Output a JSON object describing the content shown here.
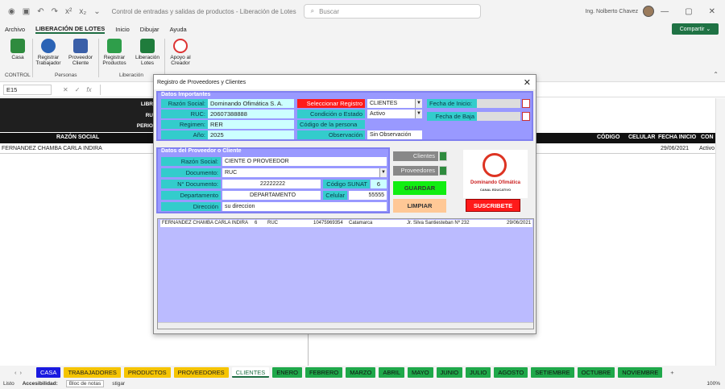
{
  "titlebar": {
    "doc_title": "Control de entradas y salidas de productos - Liberación de Lotes - copia - E...",
    "search_placeholder": "Buscar",
    "user_name": "Ing. Nolberto Chavez"
  },
  "menu": [
    "Archivo",
    "LIBERACIÓN DE LOTES",
    "Inicio",
    "Dibujar",
    "Ayuda"
  ],
  "share_label": "Compartir",
  "ribbon": {
    "buttons": [
      {
        "label": "Casa"
      },
      {
        "label": "Registrar Trabajador"
      },
      {
        "label": "Proveedor Cliente"
      },
      {
        "label": "Registrar Productos"
      },
      {
        "label": "Liberación Lotes"
      },
      {
        "label": "Apoyo al Creador"
      }
    ],
    "groups": [
      "CONTROL",
      "Personas",
      "Liberación"
    ]
  },
  "namebox": "E15",
  "sheet": {
    "dark_labels": [
      "LIBR",
      "RU",
      "PERIO"
    ],
    "header": [
      "RAZÓN SOCIAL",
      "CÓDIGO",
      "CELULAR",
      "FECHA INICIO",
      "CON"
    ],
    "row": [
      "FERNANDEZ CHAMBA CARLA INDIRA",
      "29/06/2021",
      "Activo"
    ]
  },
  "dialog": {
    "title": "Registro de Proveedores y Clientes",
    "important": {
      "heading": "Datos Importantes",
      "razon_label": "Razón Social:",
      "razon_value": "Dominando Ofimática S. A.",
      "ruc_label": "RUC:",
      "ruc_value": "20607388888",
      "regimen_label": "Regimen:",
      "regimen_value": "RER",
      "anio_label": "Año:",
      "anio_value": "2025",
      "seleccionar_label": "Seleccionar Registro",
      "seleccionar_value": "CLIENTES",
      "condicion_label": "Condición o Estado",
      "condicion_value": "Activo",
      "codigo_label": "Código de la persona",
      "observacion_label": "Observación",
      "observacion_value": "Sin Observación",
      "fecha_inicio_label": "Fecha de Inicio:",
      "fecha_baja_label": "Fecha de Baja"
    },
    "provider": {
      "heading": "Datos del Proveedor o Cliente",
      "razon_label": "Razón Social:",
      "razon_value": "CIENTE O PROVEEDOR",
      "documento_label": "Documento:",
      "documento_value": "RUC",
      "ndoc_label": "N° Documento:",
      "ndoc_value": "22222222",
      "sunat_label": "Código SUNAT",
      "sunat_value": "6",
      "depto_label": "Departamento",
      "depto_value": "DEPARTAMENTO",
      "celular_label": "Celular",
      "celular_value": "55555",
      "direccion_label": "Dirección",
      "direccion_value": "su direccion"
    },
    "buttons": {
      "clientes": "Clientes",
      "proveedores": "Proveedores",
      "guardar": "GUARDAR",
      "limpiar": "LIMPIAR",
      "suscribete": "SUSCRIBETE"
    },
    "logo_title": "Dominando Ofimática",
    "logo_sub": "CANAL EDUCATIVO",
    "list_row": [
      "FERNANDEZ CHAMBA CARLA INDIRA",
      "6",
      "RUC",
      "10475969354",
      "Catamarca",
      "Jr. Silva Santiesteban Nº 232",
      "29/06/2021"
    ]
  },
  "tabs": [
    {
      "label": "CASA",
      "bg": "#1a1ae0",
      "fg": "#ffffff"
    },
    {
      "label": "TRABAJADORES",
      "bg": "#f5c400",
      "fg": "#222222"
    },
    {
      "label": "PRODUCTOS",
      "bg": "#f5c400",
      "fg": "#222222"
    },
    {
      "label": "PROVEEDORES",
      "bg": "#f5c400",
      "fg": "#222222"
    },
    {
      "label": "CLIENTES",
      "bg": "#ffffff",
      "fg": "#1f6e43"
    },
    {
      "label": "ENERO",
      "bg": "#1fa84a",
      "fg": "#111111"
    },
    {
      "label": "FEBRERO",
      "bg": "#1fa84a",
      "fg": "#111111"
    },
    {
      "label": "MARZO",
      "bg": "#1fa84a",
      "fg": "#111111"
    },
    {
      "label": "ABRIL",
      "bg": "#1fa84a",
      "fg": "#111111"
    },
    {
      "label": "MAYO",
      "bg": "#1fa84a",
      "fg": "#111111"
    },
    {
      "label": "JUNIO",
      "bg": "#1fa84a",
      "fg": "#111111"
    },
    {
      "label": "JULIO",
      "bg": "#1fa84a",
      "fg": "#111111"
    },
    {
      "label": "AGOSTO",
      "bg": "#1fa84a",
      "fg": "#111111"
    },
    {
      "label": "SETIEMBRE",
      "bg": "#1fa84a",
      "fg": "#111111"
    },
    {
      "label": "OCTUBRE",
      "bg": "#1fa84a",
      "fg": "#111111"
    },
    {
      "label": "NOVIEMBRE",
      "bg": "#1fa84a",
      "fg": "#111111"
    }
  ],
  "status": {
    "ready": "Listo",
    "accessibility": "Accesibilidad:",
    "notes": "Bloc de notas",
    "notes_tail": "stigar",
    "zoom": "100%"
  }
}
